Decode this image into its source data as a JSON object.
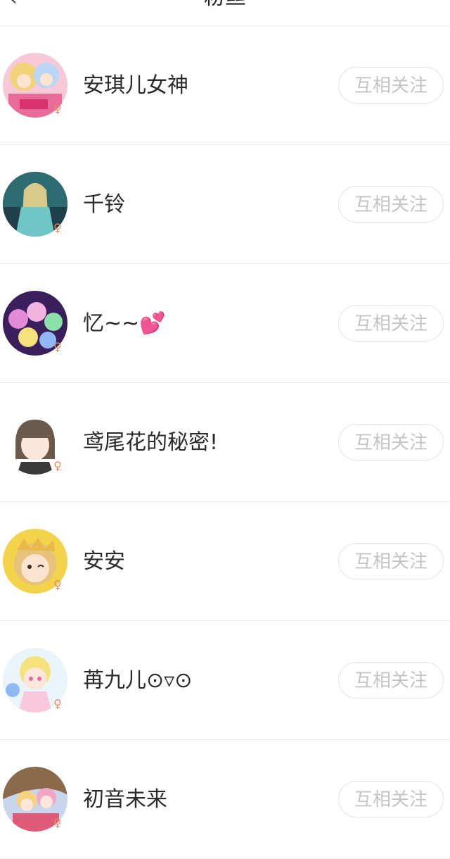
{
  "header": {
    "title": "粉丝",
    "back_icon": "back-icon"
  },
  "colors": {
    "gender_female": "#f08a5d",
    "button_text": "#c4c4c4",
    "divider": "#ededed"
  },
  "users": [
    {
      "name": "安琪儿女神",
      "gender": "♀",
      "button": "互相关注"
    },
    {
      "name": "千铃",
      "gender": "♀",
      "button": "互相关注"
    },
    {
      "name": "忆~~💕",
      "gender": "♀",
      "button": "互相关注"
    },
    {
      "name": "鸢尾花的秘密!",
      "gender": "♀",
      "button": "互相关注"
    },
    {
      "name": "安安",
      "gender": "♀",
      "button": "互相关注"
    },
    {
      "name": "苒九儿⊙▿⊙",
      "gender": "♀",
      "button": "互相关注"
    },
    {
      "name": "初音未来",
      "gender": "♀",
      "button": "互相关注"
    }
  ]
}
